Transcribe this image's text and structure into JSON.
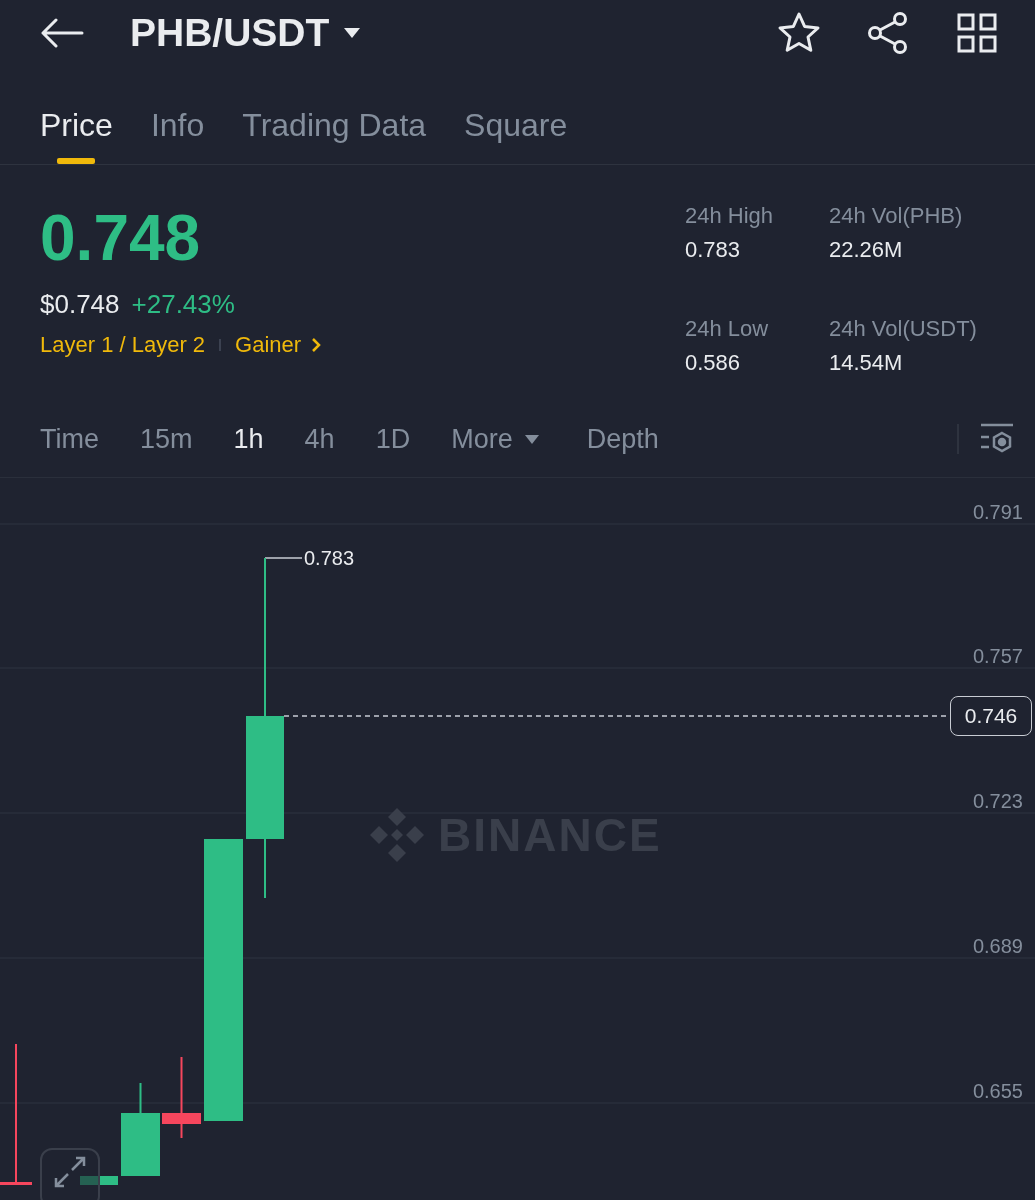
{
  "header": {
    "title": "PHB/USDT"
  },
  "tabs": [
    {
      "label": "Price",
      "selected": true
    },
    {
      "label": "Info",
      "selected": false
    },
    {
      "label": "Trading Data",
      "selected": false
    },
    {
      "label": "Square",
      "selected": false
    }
  ],
  "price": {
    "last": "0.748",
    "usd": "$0.748",
    "change": "+27.43%",
    "tags": [
      "Layer 1 / Layer 2",
      "Gainer"
    ]
  },
  "stats": [
    {
      "label": "24h High",
      "value": "0.783"
    },
    {
      "label": "24h Vol(PHB)",
      "value": "22.26M"
    },
    {
      "label": "24h Low",
      "value": "0.586"
    },
    {
      "label": "24h Vol(USDT)",
      "value": "14.54M"
    }
  ],
  "intervals": [
    {
      "label": "Time",
      "selected": false,
      "kind": "plain"
    },
    {
      "label": "15m",
      "selected": false,
      "kind": "plain"
    },
    {
      "label": "1h",
      "selected": true,
      "kind": "plain"
    },
    {
      "label": "4h",
      "selected": false,
      "kind": "plain"
    },
    {
      "label": "1D",
      "selected": false,
      "kind": "plain"
    },
    {
      "label": "More",
      "selected": false,
      "kind": "dropdown"
    },
    {
      "label": "Depth",
      "selected": false,
      "kind": "plain"
    }
  ],
  "chart": {
    "price_labels": [
      "0.791",
      "0.757",
      "0.723",
      "0.689",
      "0.655"
    ],
    "high_marker": "0.783",
    "last_price": "0.746",
    "watermark": "BINANCE"
  }
}
